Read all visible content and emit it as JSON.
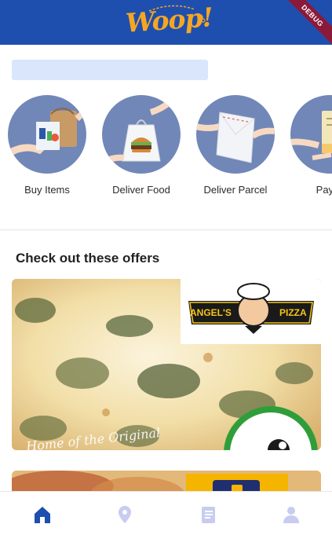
{
  "app": {
    "logo_text": "Woop!",
    "debug_banner": "DEBUG"
  },
  "services": [
    {
      "label": "Buy Items",
      "icon": "shopping-bag-icon"
    },
    {
      "label": "Deliver Food",
      "icon": "burger-bag-icon"
    },
    {
      "label": "Deliver Parcel",
      "icon": "parcel-icon"
    },
    {
      "label": "Pay B",
      "icon": "payment-icon"
    }
  ],
  "offers": {
    "title": "Check out these offers",
    "items": [
      {
        "brand_left": "ANGEL'S",
        "brand_right": "PIZZA",
        "tagline": "Home of the Original"
      }
    ]
  },
  "bottom_nav": [
    {
      "name": "home",
      "icon": "home-icon",
      "active": true
    },
    {
      "name": "location",
      "icon": "location-pin-icon",
      "active": false
    },
    {
      "name": "orders",
      "icon": "book-icon",
      "active": false
    },
    {
      "name": "profile",
      "icon": "person-icon",
      "active": false
    }
  ],
  "colors": {
    "primary": "#1f4fae",
    "accent": "#f5a623",
    "nav_active": "#1f4fae",
    "nav_inactive": "#c8ccf0"
  }
}
